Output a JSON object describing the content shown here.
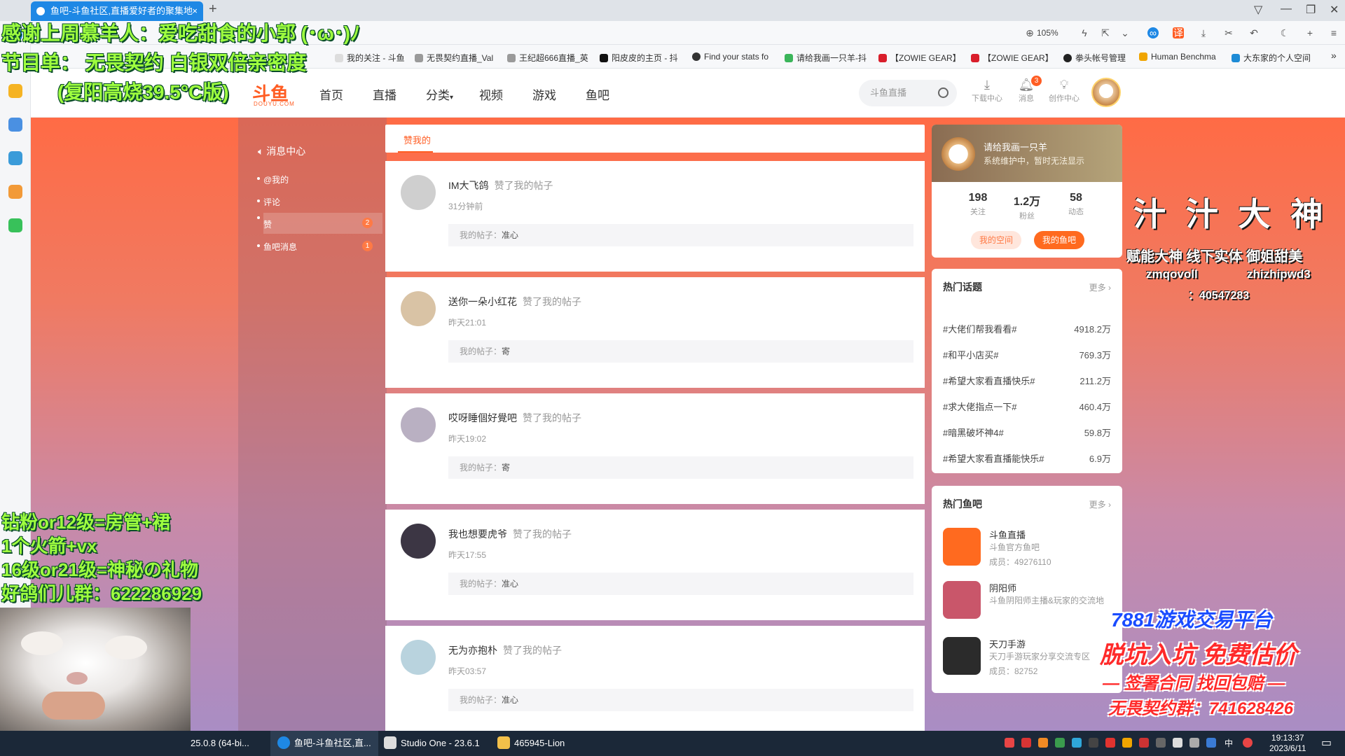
{
  "browser": {
    "tab_title": "鱼吧-斗鱼社区,直播爱好者的聚集地",
    "tab_close": "×",
    "new_tab": "+",
    "zoom": "105%"
  },
  "bookmarks": [
    {
      "label": "我的关注 - 斗鱼",
      "color": "#ffffff"
    },
    {
      "label": "无畏契约直播_Val",
      "color": "#9a9a9a"
    },
    {
      "label": "王纪超666直播_英",
      "color": "#9a9a9a"
    },
    {
      "label": "阳皮皮的主页 - 抖",
      "color": "#111111"
    },
    {
      "label": "Find your stats fo",
      "color": "#333333"
    },
    {
      "label": "请给我画一只羊-抖",
      "color": "#3bb55a"
    },
    {
      "label": "【ZOWIE GEAR】",
      "color": "#d91e2b"
    },
    {
      "label": "【ZOWIE GEAR】",
      "color": "#d91e2b"
    },
    {
      "label": "拳头帐号管理",
      "color": "#222222"
    },
    {
      "label": "Human Benchma",
      "color": "#f0a500"
    },
    {
      "label": "大东家的个人空间",
      "color": "#1d8bd6"
    }
  ],
  "site": {
    "logo": "斗鱼",
    "logo_sub": "DOUYU.COM",
    "nav": [
      "首页",
      "直播",
      "分类",
      "视频",
      "游戏",
      "鱼吧"
    ],
    "search_placeholder": "斗鱼直播",
    "header_icons": [
      {
        "label": "下载中心",
        "icon": "download-icon"
      },
      {
        "label": "消息",
        "icon": "bell-icon",
        "badge": "3"
      },
      {
        "label": "创作中心",
        "icon": "bulb-icon"
      }
    ]
  },
  "leftnav": {
    "title": "消息中心",
    "items": [
      {
        "label": "@我的",
        "badge": ""
      },
      {
        "label": "评论",
        "badge": ""
      },
      {
        "label": "赞",
        "badge": "2"
      },
      {
        "label": "鱼吧消息",
        "badge": "1"
      }
    ]
  },
  "feed": {
    "tab": "赞我的",
    "items": [
      {
        "name": "IM大飞鸽",
        "action": "赞了我的帖子",
        "time": "31分钟前",
        "post_prefix": "我的帖子：",
        "post": "准心",
        "avatar_color": "#cfcfcf"
      },
      {
        "name": "送你一朵小红花",
        "action": "赞了我的帖子",
        "time": "昨天21:01",
        "post_prefix": "我的帖子：",
        "post": "寄",
        "avatar_color": "#d9c3a5"
      },
      {
        "name": "哎呀睡個好覺吧",
        "action": "赞了我的帖子",
        "time": "昨天19:02",
        "post_prefix": "我的帖子：",
        "post": "寄",
        "avatar_color": "#b9b0c2"
      },
      {
        "name": "我也想要虎爷",
        "action": "赞了我的帖子",
        "time": "昨天17:55",
        "post_prefix": "我的帖子：",
        "post": "准心",
        "avatar_color": "#3c3644"
      },
      {
        "name": "无为亦抱朴",
        "action": "赞了我的帖子",
        "time": "昨天03:57",
        "post_prefix": "我的帖子：",
        "post": "准心",
        "avatar_color": "#b9d3de"
      }
    ]
  },
  "profile": {
    "name": "请给我画一只羊",
    "note": "系统维护中，暂时无法显示",
    "stats": [
      {
        "value": "198",
        "label": "关注"
      },
      {
        "value": "1.2万",
        "label": "粉丝"
      },
      {
        "value": "58",
        "label": "动态"
      }
    ],
    "btn_space": "我的空间",
    "btn_fishbar": "我的鱼吧"
  },
  "hot_topics": {
    "title": "热门话题",
    "more": "更多 ›",
    "items": [
      {
        "topic": "#大佬们帮我看看#",
        "value": "4918.2万"
      },
      {
        "topic": "#和平小店买#",
        "value": "769.3万"
      },
      {
        "topic": "#希望大家看直播快乐#",
        "value": "211.2万"
      },
      {
        "topic": "#求大佬指点一下#",
        "value": "460.4万"
      },
      {
        "topic": "#暗黑破坏神4#",
        "value": "59.8万"
      },
      {
        "topic": "#希望大家看直播能快乐#",
        "value": "6.9万"
      }
    ]
  },
  "hot_bars": {
    "title": "热门鱼吧",
    "more": "更多 ›",
    "items": [
      {
        "name": "斗鱼直播",
        "desc": "斗鱼官方鱼吧",
        "members": "成员：49276110",
        "color": "#ff6a1f"
      },
      {
        "name": "阴阳师",
        "desc": "斗鱼阴阳师主播&玩家的交流地",
        "members": "",
        "color": "#c9566a"
      },
      {
        "name": "天刀手游",
        "desc": "天刀手游玩家分享交流专区",
        "members": "成员：82752",
        "color": "#2b2b2b"
      }
    ]
  },
  "overlay": {
    "thanks": "感谢上周慕羊人：爱吃甜食的小郭 (･ω･)ﾉ",
    "program": "节目单：  无畏契约 白银双倍亲密度",
    "program_sub": "(复阳高烧39.5°C版)",
    "left_lines": [
      "钻粉or12级=房管+裙",
      "1个火箭+vx",
      "16级or21级=神秘の礼物",
      "好鸽们儿群：622286929"
    ],
    "title_right": "汁 汁 大 神",
    "sub_right": "赋能大神 线下实体 御姐甜美",
    "id_left": "zmqovoll",
    "id_right": "zhizhipwd3",
    "qq": "：40547283",
    "ad_line1": "7881游戏交易平台",
    "ad_line2": "脱坑入坑 免费估价",
    "ad_line3": "— 签署合同 找回包赔 —",
    "ad_line4": "无畏契约群：741628426"
  },
  "taskbar": {
    "items": [
      {
        "label": "25.0.8 (64-bi...",
        "color": "#222222"
      },
      {
        "label": "鱼吧-斗鱼社区,直...",
        "color": "#1e88e5"
      },
      {
        "label": "Studio One - 23.6.1",
        "color": "#dddddd"
      },
      {
        "label": "465945-Lion",
        "color": "#f2c04a"
      }
    ],
    "time": "19:13:37",
    "date": "2023/6/11",
    "ime": "中"
  },
  "colors": {
    "accent": "#ff5d23"
  }
}
